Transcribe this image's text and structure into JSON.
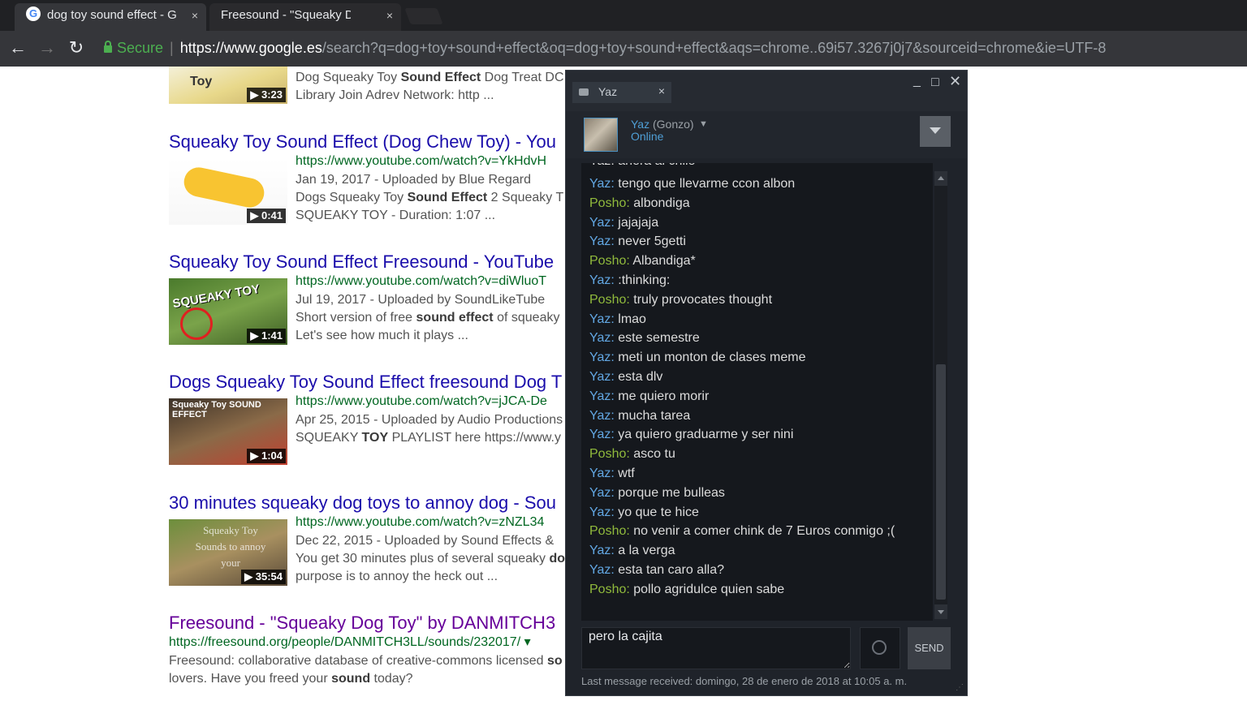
{
  "browser": {
    "tabs": [
      {
        "title": "dog toy sound effect - G",
        "close": "×"
      },
      {
        "title": "Freesound - \"Squeaky Do",
        "close": "×"
      }
    ],
    "omnibox": {
      "secure_label": "Secure",
      "separator": "|",
      "host": "https://www.google.es",
      "path": "/search?q=dog+toy+sound+effect&oq=dog+toy+sound+effect&aqs=chrome..69i57.3267j0j7&sourceid=chrome&ie=UTF-8"
    },
    "nav": {
      "back": "←",
      "forward": "→",
      "reload": "↻"
    }
  },
  "results": [
    {
      "snippet1_pre": "Dog Squeaky Toy ",
      "snippet1_bold": "Sound Effect",
      "snippet1_post": " Dog Treat DC",
      "snippet2": "Library Join Adrev Network: http ...",
      "duration": "▶ 3:23",
      "thumb_text": "Toy"
    },
    {
      "title": "Squeaky Toy Sound Effect (Dog Chew Toy) - You",
      "url": "https://www.youtube.com/watch?v=YkHdvH",
      "meta": "Jan 19, 2017 - Uploaded by Blue Regard",
      "snippet1_pre": "Dogs Squeaky Toy ",
      "snippet1_bold": "Sound Effect",
      "snippet1_post": " 2 Squeaky T",
      "snippet2": "SQUEAKY TOY - Duration: 1:07 ...",
      "duration": "▶ 0:41"
    },
    {
      "title": "Squeaky Toy Sound Effect Freesound - YouTube",
      "url": "https://www.youtube.com/watch?v=diWluoT",
      "meta": "Jul 19, 2017 - Uploaded by SoundLikeTube",
      "snippet1_pre": "Short version of free ",
      "snippet1_bold": "sound effect",
      "snippet1_post": " of squeaky",
      "snippet2": "Let's see how much it plays ...",
      "duration": "▶ 1:41",
      "thumb_text": "SQUEAKY TOY"
    },
    {
      "title": "Dogs Squeaky Toy Sound Effect freesound Dog T",
      "url": "https://www.youtube.com/watch?v=jJCA-De",
      "meta": "Apr 25, 2015 - Uploaded by Audio Productions",
      "snippet1_pre": "SQUEAKY ",
      "snippet1_bold": "TOY",
      "snippet1_post": " PLAYLIST here https://www.y",
      "duration": "▶ 1:04",
      "thumb_text": "Squeaky Toy SOUND EFFECT"
    },
    {
      "title": "30 minutes squeaky dog toys to annoy dog - Sou",
      "url": "https://www.youtube.com/watch?v=zNZL34",
      "meta": "Dec 22, 2015 - Uploaded by Sound Effects &",
      "snippet1_pre": "You get 30 minutes plus of several squeaky ",
      "snippet1_bold": "do",
      "snippet1_post": "",
      "snippet2": "purpose is to annoy the heck out ...",
      "duration": "▶ 35:54",
      "thumb_text": "Squeaky Toy Sounds to annoy your"
    },
    {
      "title": "Freesound - \"Squeaky Dog Toy\" by DANMITCH3",
      "url": "https://freesound.org/people/DANMITCH3LL/sounds/232017/ ▾",
      "snippet1_pre": "Freesound: collaborative database of creative-commons licensed ",
      "snippet1_bold": "so",
      "snippet1_post": "",
      "snippet2_pre": "lovers. Have you freed your ",
      "snippet2_bold": "sound",
      "snippet2_post": " today?"
    }
  ],
  "chat": {
    "tab_name": "Yaz",
    "tab_close": "×",
    "window_controls": {
      "minimize": "_",
      "maximize": "□",
      "close": "✕"
    },
    "friend": {
      "name": "Yaz",
      "nickname": " (Gonzo)",
      "caret": "▼",
      "status": "Online"
    },
    "partial_top_line": "Yaz: ahora al chile",
    "messages": [
      {
        "sender": "Yaz:",
        "text": " tengo que llevarme ccon albon",
        "who": "yaz"
      },
      {
        "sender": "Posho:",
        "text": " albondiga",
        "who": "posho"
      },
      {
        "sender": "Yaz:",
        "text": " jajajaja",
        "who": "yaz"
      },
      {
        "sender": "Yaz:",
        "text": " never 5getti",
        "who": "yaz"
      },
      {
        "sender": "Posho:",
        "text": " Albandiga*",
        "who": "posho"
      },
      {
        "sender": "Yaz:",
        "text": " :thinking:",
        "who": "yaz"
      },
      {
        "sender": "Posho:",
        "text": " truly provocates thought",
        "who": "posho"
      },
      {
        "sender": "Yaz:",
        "text": " lmao",
        "who": "yaz"
      },
      {
        "sender": "Yaz:",
        "text": " este semestre",
        "who": "yaz"
      },
      {
        "sender": "Yaz:",
        "text": " meti un monton de clases meme",
        "who": "yaz"
      },
      {
        "sender": "Yaz:",
        "text": " esta dlv",
        "who": "yaz"
      },
      {
        "sender": "Yaz:",
        "text": " me quiero morir",
        "who": "yaz"
      },
      {
        "sender": "Yaz:",
        "text": " mucha tarea",
        "who": "yaz"
      },
      {
        "sender": "Yaz:",
        "text": " ya quiero graduarme y ser nini",
        "who": "yaz"
      },
      {
        "sender": "Posho:",
        "text": " asco tu",
        "who": "posho"
      },
      {
        "sender": "Yaz:",
        "text": " wtf",
        "who": "yaz"
      },
      {
        "sender": "Yaz:",
        "text": " porque me bulleas",
        "who": "yaz"
      },
      {
        "sender": "Yaz:",
        "text": " yo que te hice",
        "who": "yaz"
      },
      {
        "sender": "Posho:",
        "text": " no venir a comer chink de 7 Euros conmigo ;(",
        "who": "posho"
      },
      {
        "sender": "Yaz:",
        "text": " a la verga",
        "who": "yaz"
      },
      {
        "sender": "Yaz:",
        "text": " esta tan caro alla?",
        "who": "yaz"
      },
      {
        "sender": "Posho:",
        "text": " pollo agridulce quien sabe",
        "who": "posho"
      }
    ],
    "input_value": "pero la cajita",
    "send_label": "SEND",
    "last_message": "Last message received: domingo, 28 de enero de 2018 at 10:05 a. m.",
    "colors": {
      "yaz": "#62a7e3",
      "posho": "#90ba3c"
    }
  }
}
